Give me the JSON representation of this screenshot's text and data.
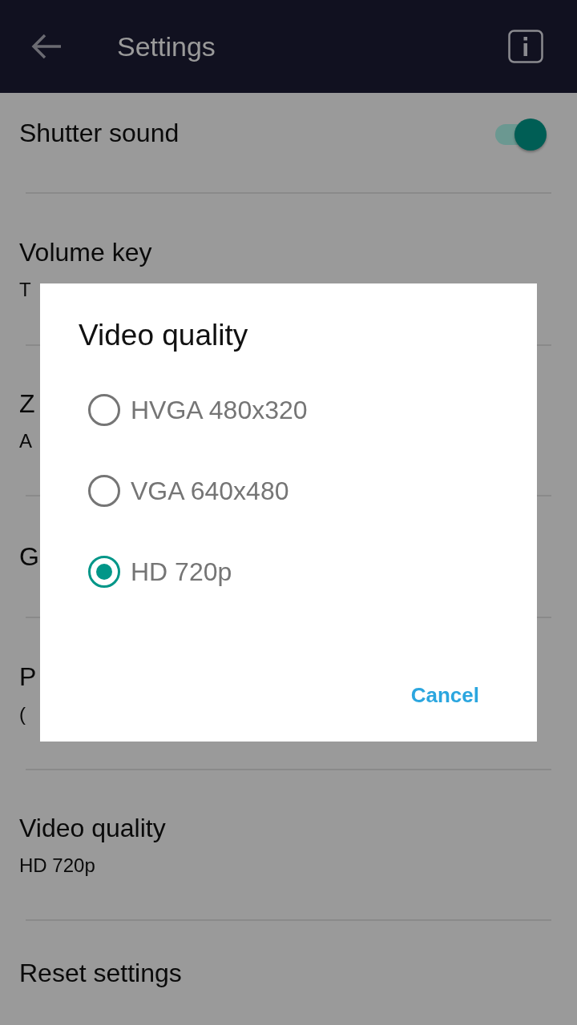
{
  "toolbar": {
    "title": "Settings"
  },
  "settings": [
    {
      "kind": "switch",
      "title": "Shutter sound",
      "on": true
    },
    {
      "kind": "text",
      "title": "Volume key",
      "subtitle": "T"
    },
    {
      "kind": "text",
      "title": "Z",
      "subtitle": "A"
    },
    {
      "kind": "text",
      "title": "G"
    },
    {
      "kind": "text",
      "title": "P",
      "subtitle": "("
    },
    {
      "kind": "text",
      "title": "Video quality",
      "subtitle": "HD 720p"
    },
    {
      "kind": "text",
      "title": "Reset settings"
    }
  ],
  "dialog": {
    "title": "Video quality",
    "options": [
      {
        "label": "HVGA 480x320",
        "selected": false
      },
      {
        "label": "VGA 640x480",
        "selected": false
      },
      {
        "label": "HD 720p",
        "selected": true
      }
    ],
    "buttons": [
      "Cancel"
    ]
  }
}
